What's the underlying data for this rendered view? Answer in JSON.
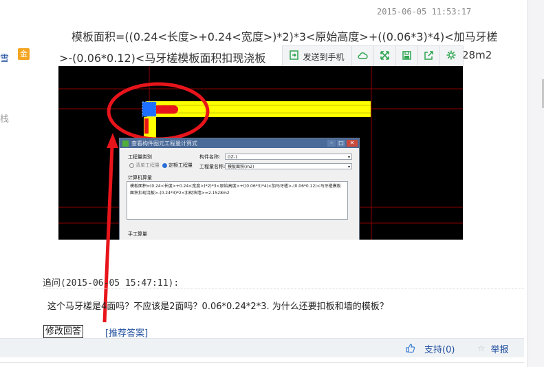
{
  "timestamp": "2015-06-05 11:53:17",
  "sidebar": {
    "name_fragment": "雪",
    "badge": "金",
    "frag": "栈"
  },
  "answer": {
    "formula_line1": "模板面积=((0.24<长度>+0.24<宽度>)*2)*3<原始高度>+((0.06*3)*4)<加马牙槎",
    "formula_line2": ">-(0.06*0.12)<马牙槎模板面积扣现浇板",
    "formula_tail": "28m2"
  },
  "share_toolbar": {
    "send_label": "发送到手机",
    "icons": [
      "phone-send-icon",
      "cloud-icon",
      "fullscreen-icon",
      "save-icon",
      "share-icon",
      "settings-icon"
    ]
  },
  "cad": {
    "dialog": {
      "title": "查看构件图元工程量计算式",
      "group_label": "工程量类别",
      "radio_qd": "清单工程量",
      "radio_de": "定额工程量",
      "component_label": "构件名称:",
      "component_value": "GZ-1",
      "qty_label": "工程量名称:",
      "qty_value": "模板面积(m2)",
      "calc_label": "计算机算量",
      "calc_text": "模板面积=(0.24<长度>+0.24<宽度>)*2)*3<原始高度>+((0.06*3)*4)<加马牙槎>-(0.06*0.12)<马牙槎模板面积扣现浇板>-(0.24*3)*2<扣砌块墙>=2.1528m2",
      "manual_label": "手工算量"
    },
    "colors": {
      "highlight": "#ffff00",
      "annot": "#e8141b",
      "grid": "#8b0000",
      "selected": "#1e6fff"
    }
  },
  "followup": {
    "label": "追问(2015-06-05 15:47:11):",
    "text": "这个马牙槎是4面吗？不应该是2面吗？0.06*0.24*2*3. 为什么还要扣板和墙的模板？"
  },
  "actions": {
    "modify": "修改回答",
    "recommend": "[推荐答案]",
    "support": "支持(0)",
    "report": "举报"
  }
}
